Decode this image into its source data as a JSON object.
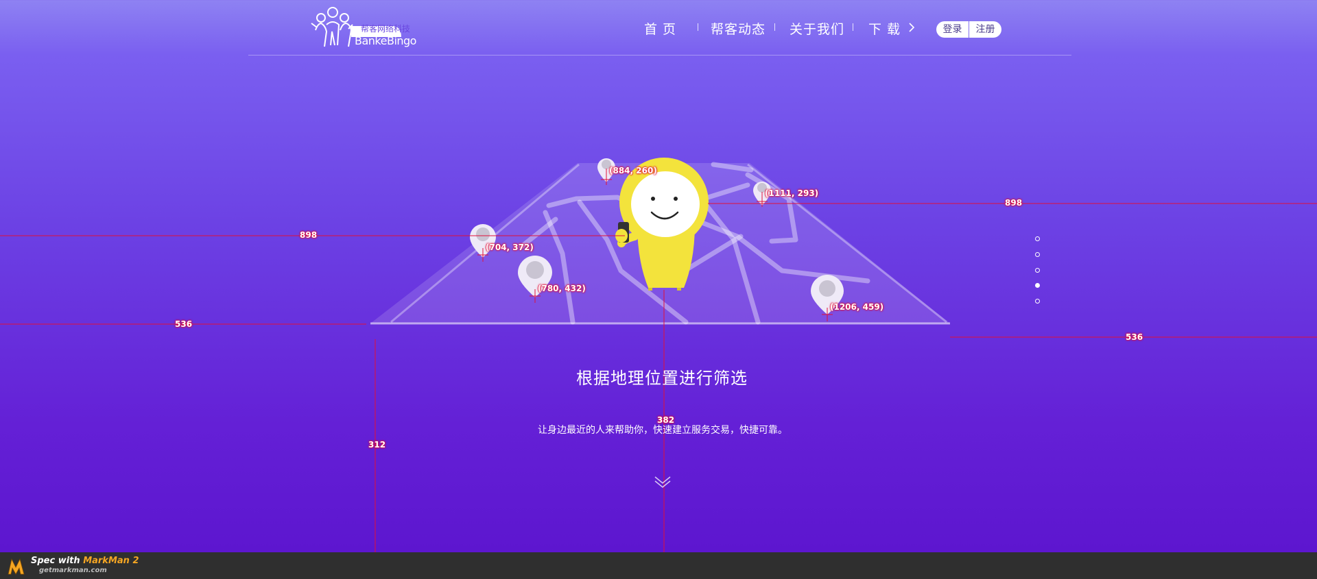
{
  "header": {
    "logo": {
      "name": "BankeBingo",
      "tagline": "帮客网络科技",
      "icon": "people-group-logo"
    },
    "nav": [
      "首 页",
      "帮客动态",
      "关于我们",
      "下 载"
    ],
    "download_icon": "chevron-right-icon",
    "login_label": "登录",
    "register_label": "注册"
  },
  "hero": {
    "illustration": "map-with-yellow-character",
    "pins": [
      {
        "label": "(884, 260)"
      },
      {
        "label": "(1111, 293)"
      },
      {
        "label": "(704, 372)"
      },
      {
        "label": "(780, 432)"
      },
      {
        "label": "(1206, 459)"
      }
    ],
    "title": "根据地理位置进行筛选",
    "subtitle": "让身边最近的人来帮助你，快速建立服务交易，快捷可靠。",
    "scroll_icon": "double-chevron-down-icon"
  },
  "pagination": {
    "total": 5,
    "active_index": 3
  },
  "measurements": [
    {
      "id": "left-top",
      "value": "898"
    },
    {
      "id": "right-top",
      "value": "898"
    },
    {
      "id": "left-base",
      "value": "536"
    },
    {
      "id": "right-base",
      "value": "536"
    },
    {
      "id": "left-height",
      "value": "312"
    },
    {
      "id": "center-height",
      "value": "382"
    }
  ],
  "footer": {
    "spec_prefix": "Spec with ",
    "brand": "MarkMan 2",
    "site": "getmarkman.com"
  },
  "colors": {
    "accent": "#6a2fe0",
    "character": "#f3e33c",
    "annotation": "#e0103a",
    "footer_bg": "#2f2f2f",
    "markman_orange": "#f5a623"
  }
}
